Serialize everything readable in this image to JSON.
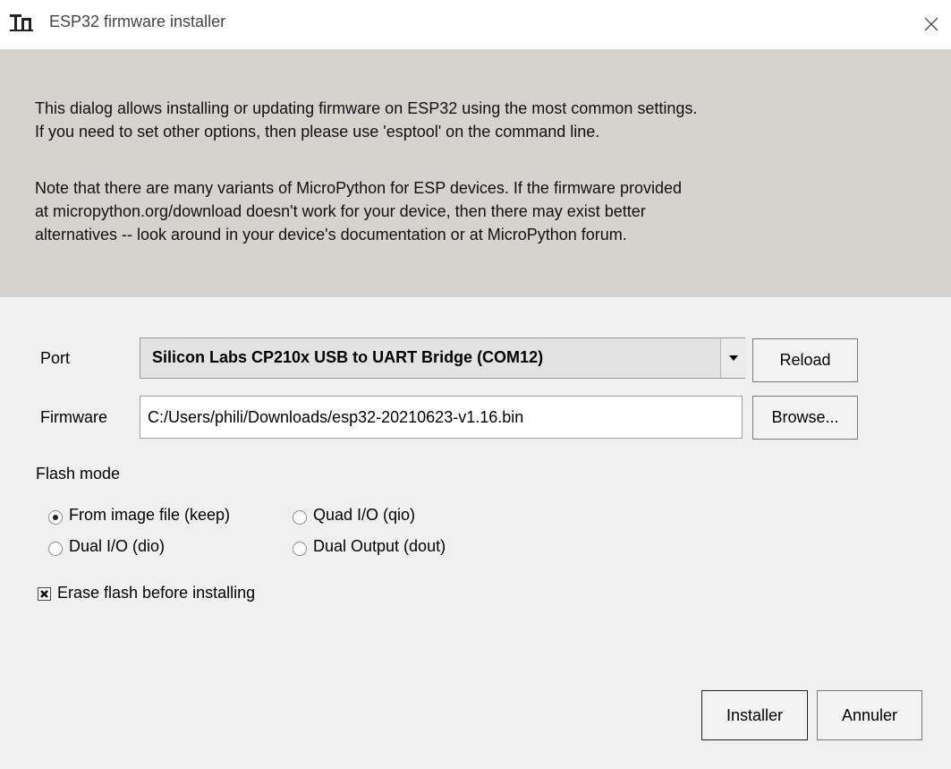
{
  "window": {
    "title": "ESP32 firmware installer",
    "app_icon": "thonny-logo-icon",
    "close_icon": "close-icon"
  },
  "info": {
    "paragraph1": "This dialog allows installing or updating firmware on ESP32 using the most common settings.\nIf you need to set other options, then please use 'esptool' on the command line.",
    "paragraph2": "Note that there are many variants of MicroPython for ESP devices. If the firmware provided\nat micropython.org/download doesn't work for your device, then there may exist better\nalternatives -- look around in your device's documentation or at MicroPython forum."
  },
  "port": {
    "label": "Port",
    "selected": "Silicon Labs CP210x USB to UART Bridge (COM12)",
    "reload_label": "Reload"
  },
  "firmware": {
    "label": "Firmware",
    "value": "C:/Users/phili/Downloads/esp32-20210623-v1.16.bin",
    "browse_label": "Browse..."
  },
  "flash_mode": {
    "label": "Flash mode",
    "options": [
      {
        "label": "From image file (keep)",
        "selected": true
      },
      {
        "label": "Quad I/O (qio)",
        "selected": false
      },
      {
        "label": "Dual I/O (dio)",
        "selected": false
      },
      {
        "label": "Dual Output (dout)",
        "selected": false
      }
    ]
  },
  "erase": {
    "label": "Erase flash before installing",
    "checked": true
  },
  "actions": {
    "install_label": "Installer",
    "cancel_label": "Annuler"
  }
}
